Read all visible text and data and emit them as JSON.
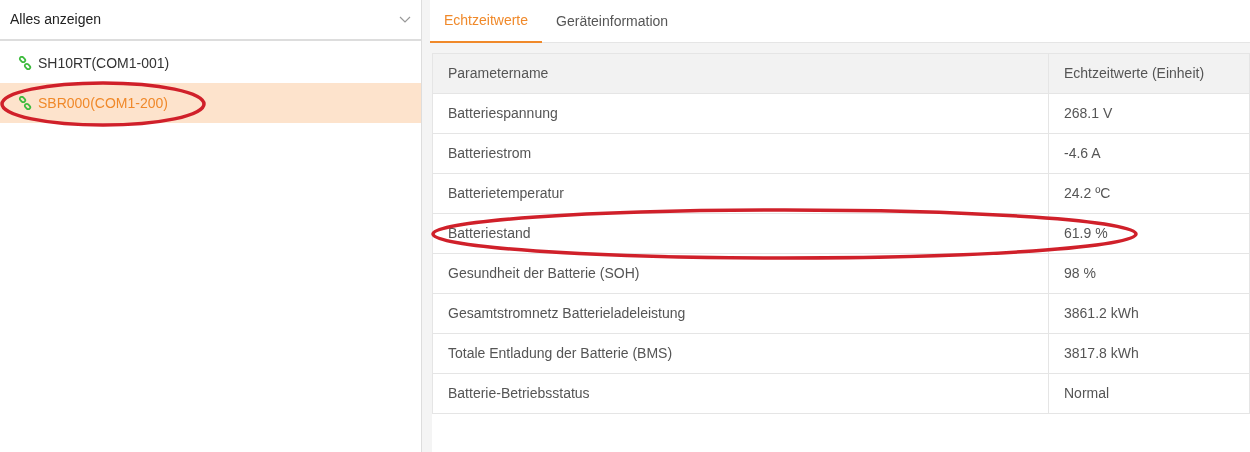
{
  "filter": {
    "value": "Alles anzeigen"
  },
  "devices": [
    {
      "label": "SH10RT(COM1-001)",
      "selected": false,
      "circled": false
    },
    {
      "label": "SBR000(COM1-200)",
      "selected": true,
      "circled": true
    }
  ],
  "tabs": [
    {
      "label": "Echtzeitwerte",
      "selected": true
    },
    {
      "label": "Geräteinformation",
      "selected": false
    }
  ],
  "table": {
    "columns": [
      "Parametername",
      "Echtzeitwerte (Einheit)"
    ],
    "rows": [
      {
        "name": "Batteriespannung",
        "value": "268.1 V",
        "circled": false
      },
      {
        "name": "Batteriestrom",
        "value": "-4.6 A",
        "circled": false
      },
      {
        "name": "Batterietemperatur",
        "value": "24.2 ºC",
        "circled": false
      },
      {
        "name": "Batteriestand",
        "value": "61.9 %",
        "circled": true
      },
      {
        "name": "Gesundheit der Batterie (SOH)",
        "value": "98 %",
        "circled": false
      },
      {
        "name": "Gesamtstromnetz Batterieladeleistung",
        "value": "3861.2 kWh",
        "circled": false
      },
      {
        "name": "Totale Entladung der Batterie (BMS)",
        "value": "3817.8 kWh",
        "circled": false
      },
      {
        "name": "Batterie-Betriebsstatus",
        "value": "Normal",
        "circled": false
      }
    ]
  }
}
